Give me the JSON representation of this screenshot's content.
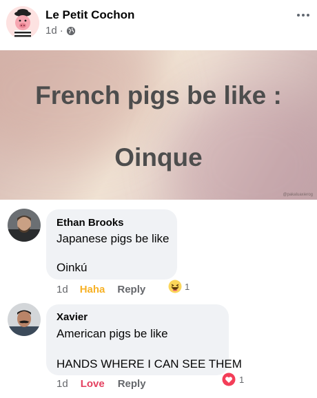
{
  "post": {
    "page_name": "Le Petit Cochon",
    "time": "1d",
    "separator": "·",
    "privacy_icon": "globe-icon",
    "more_icon": "more-icon"
  },
  "meme": {
    "line1": "French pigs be like :",
    "line2": "Oinque",
    "watermark": "@pakaluaxierog"
  },
  "comments": [
    {
      "author": "Ethan Brooks",
      "text_line1": "Japanese pigs be like",
      "text_line2": "Oinkú",
      "time": "1d",
      "reaction_label": "Haha",
      "reply_label": "Reply",
      "reaction_icon": "haha-emoji-icon",
      "reaction_count": "1"
    },
    {
      "author": "Xavier",
      "text_line1": "American pigs be like",
      "text_line2": "HANDS WHERE I CAN SEE THEM",
      "time": "1d",
      "reaction_label": "Love",
      "reply_label": "Reply",
      "reaction_icon": "heart-icon",
      "reaction_count": "1"
    }
  ],
  "colors": {
    "haha": "#f7b125",
    "love": "#e4405f",
    "bubble": "#f0f2f5",
    "meta_gray": "#65676b"
  }
}
